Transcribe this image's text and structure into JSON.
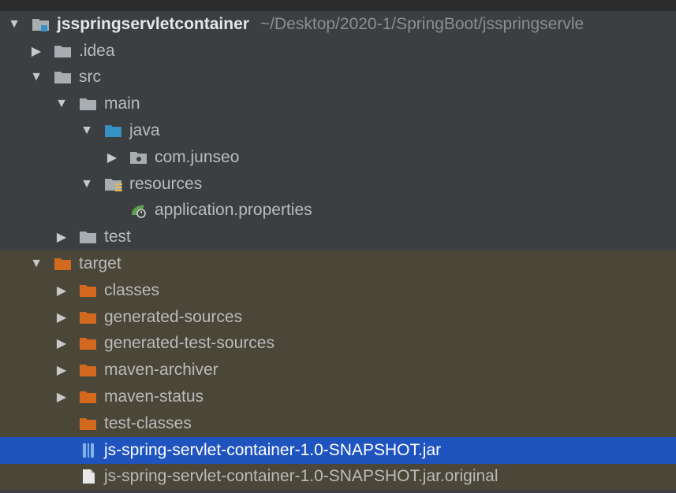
{
  "project": {
    "name": "jsspringservletcontainer",
    "path": "~/Desktop/2020-1/SpringBoot/jsspringservle"
  },
  "tree": {
    "idea": ".idea",
    "src": "src",
    "main": "main",
    "java": "java",
    "package": "com.junseo",
    "resources": "resources",
    "app_props": "application.properties",
    "test": "test",
    "target": "target",
    "classes": "classes",
    "generated_sources": "generated-sources",
    "generated_test_sources": "generated-test-sources",
    "maven_archiver": "maven-archiver",
    "maven_status": "maven-status",
    "test_classes": "test-classes",
    "jar": "js-spring-servlet-container-1.0-SNAPSHOT.jar",
    "jar_original": "js-spring-servlet-container-1.0-SNAPSHOT.jar.original"
  },
  "colors": {
    "background": "#3c3f41",
    "excluded_background": "#4a4638",
    "selection": "#1f54bf",
    "folder_gray": "#a8adb2",
    "folder_blue": "#3592c4",
    "folder_orange": "#d2691e"
  },
  "icons": {
    "expanded": "chevron-down-icon",
    "collapsed": "chevron-right-icon"
  }
}
